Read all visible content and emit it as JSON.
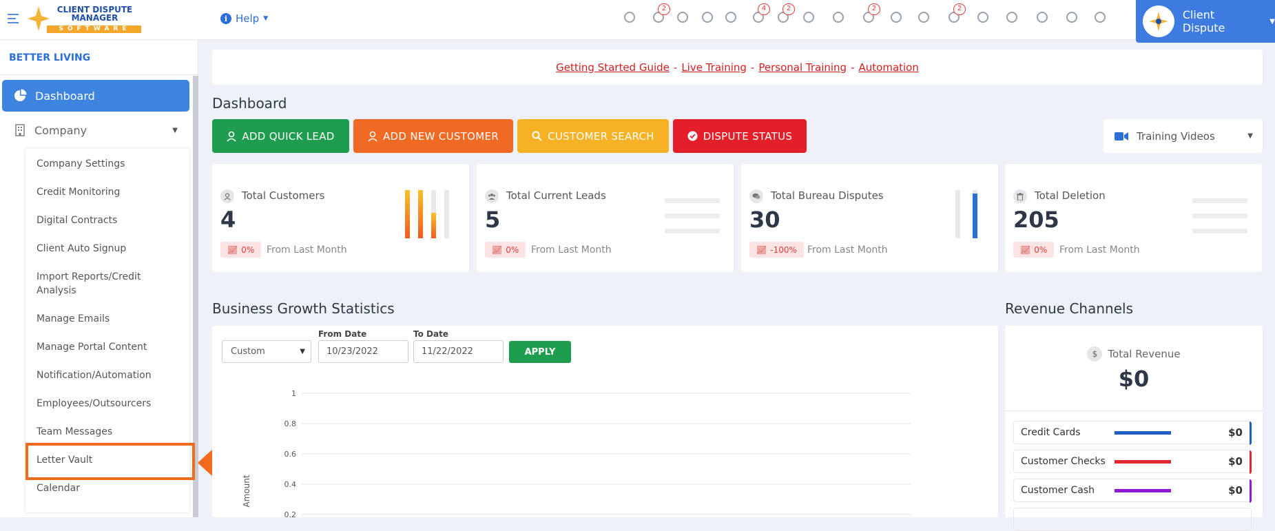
{
  "header": {
    "help_label": "Help",
    "user_name": "Client Dispute",
    "logo_line1": "CLIENT DISPUTE",
    "logo_line2": "MANAGER",
    "logo_line3": "SOFTWARE",
    "icons": [
      {
        "name": "tasks-icon",
        "badge": ""
      },
      {
        "name": "bell-icon",
        "badge": "2"
      },
      {
        "name": "support-agent-icon",
        "badge": ""
      },
      {
        "name": "dollar-icon",
        "badge": ""
      },
      {
        "name": "user-tie-icon",
        "badge": ""
      },
      {
        "name": "pen-icon",
        "badge": "4"
      },
      {
        "name": "document-icon",
        "badge": "2"
      },
      {
        "name": "envelope-icon",
        "badge": ""
      },
      {
        "name": "sitemap-icon",
        "badge": ""
      },
      {
        "name": "info-icon",
        "badge": "2"
      },
      {
        "name": "globe-icon",
        "badge": ""
      },
      {
        "name": "users-icon",
        "badge": ""
      },
      {
        "name": "warning-icon",
        "badge": "2"
      },
      {
        "name": "mail-open-icon",
        "badge": ""
      },
      {
        "name": "money-icon",
        "badge": ""
      },
      {
        "name": "inbox-icon",
        "badge": ""
      },
      {
        "name": "chat-icon",
        "badge": ""
      },
      {
        "name": "copy-icon",
        "badge": ""
      }
    ]
  },
  "sidebar": {
    "org_name": "BETTER LIVING",
    "dashboard_label": "Dashboard",
    "company_label": "Company",
    "submenu": [
      "Company Settings",
      "Credit Monitoring",
      "Digital Contracts",
      "Client Auto Signup",
      "Import Reports/Credit Analysis",
      "Manage Emails",
      "Manage Portal Content",
      "Notification/Automation",
      "Employees/Outsourcers",
      "Team Messages",
      "Letter Vault",
      "Calendar"
    ]
  },
  "links": {
    "getting_started": "Getting Started Guide",
    "live_training": "Live Training",
    "personal_training": "Personal Training",
    "automation": "Automation",
    "sep": "-"
  },
  "main": {
    "title": "Dashboard",
    "buttons": {
      "quick_lead": "ADD QUICK LEAD",
      "new_customer": "ADD NEW CUSTOMER",
      "customer_search": "CUSTOMER SEARCH",
      "dispute_status": "DISPUTE STATUS"
    },
    "training_videos": "Training Videos",
    "cards": [
      {
        "label": "Total Customers",
        "value": "4",
        "change": "0%",
        "from": "From Last Month"
      },
      {
        "label": "Total Current Leads",
        "value": "5",
        "change": "0%",
        "from": "From Last Month"
      },
      {
        "label": "Total Bureau Disputes",
        "value": "30",
        "change": "-100%",
        "from": "From Last Month"
      },
      {
        "label": "Total Deletion",
        "value": "205",
        "change": "0%",
        "from": "From Last Month"
      }
    ]
  },
  "growth": {
    "title": "Business Growth Statistics",
    "range_select": "Custom",
    "from_label": "From Date",
    "from_value": "10/23/2022",
    "to_label": "To Date",
    "to_value": "11/22/2022",
    "apply_label": "APPLY",
    "y_axis_label": "Amount",
    "y_ticks": [
      "1",
      "0.8",
      "0.6",
      "0.4",
      "0.2"
    ]
  },
  "revenue": {
    "title": "Revenue Channels",
    "total_label": "Total Revenue",
    "total_value": "$0",
    "rows": [
      {
        "label": "Credit Cards",
        "value": "$0",
        "color": "#1f5fc4"
      },
      {
        "label": "Customer Checks",
        "value": "$0",
        "color": "#e0282e"
      },
      {
        "label": "Customer Cash",
        "value": "$0",
        "color": "#8e1ad6"
      }
    ]
  },
  "colors": {
    "primary": "#3d84de",
    "green": "#1f9d4f",
    "orange": "#f06a24",
    "yellow": "#f7b125",
    "red": "#e3202a",
    "highlight": "#f26b1d"
  }
}
